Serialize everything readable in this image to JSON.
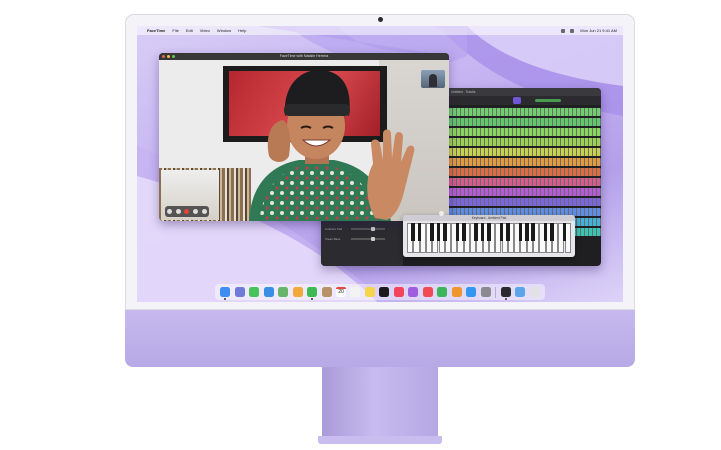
{
  "menubar": {
    "apple": "",
    "app": "FaceTime",
    "items": [
      "File",
      "Edit",
      "Video",
      "Window",
      "Help"
    ],
    "clock": "Mon Jun 21 9:41 AM"
  },
  "facetime": {
    "title": "FaceTime with Natalie Herrera"
  },
  "logic": {
    "title": "Untitled - Tracks",
    "mixer_rows": [
      "Input Chorus",
      "Ambient Pad",
      "Clean Bass"
    ],
    "track_colors": [
      "#6fd16c",
      "#5fca6a",
      "#86d85a",
      "#9ad34f",
      "#c8d24b",
      "#e59a3c",
      "#e06b3f",
      "#d85a8d",
      "#b75ad8",
      "#7c65e2",
      "#5d8de6",
      "#3fb3d9",
      "#35c7b4"
    ]
  },
  "keyboard": {
    "title": "Keyboard - Ambient Pad"
  },
  "dock": {
    "calendar_day": "20",
    "icons": [
      {
        "name": "finder-icon",
        "color": "#3d8ef0"
      },
      {
        "name": "launchpad-icon",
        "color": "#6e7bd8"
      },
      {
        "name": "messages-icon",
        "color": "#46c35a"
      },
      {
        "name": "mail-icon",
        "color": "#3a8ee6"
      },
      {
        "name": "maps-icon",
        "color": "#67b56a"
      },
      {
        "name": "photos-icon",
        "color": "#f1a93c"
      },
      {
        "name": "facetime-icon",
        "color": "#3dbb52"
      },
      {
        "name": "contacts-icon",
        "color": "#b9926a"
      },
      {
        "name": "calendar-icon",
        "color": "#ffffff"
      },
      {
        "name": "reminders-icon",
        "color": "#f3f3f3"
      },
      {
        "name": "notes-icon",
        "color": "#f6d44c"
      },
      {
        "name": "tv-icon",
        "color": "#1b1b1d"
      },
      {
        "name": "music-icon",
        "color": "#f3445e"
      },
      {
        "name": "podcasts-icon",
        "color": "#a05de0"
      },
      {
        "name": "news-icon",
        "color": "#f04b55"
      },
      {
        "name": "numbers-icon",
        "color": "#3ab55a"
      },
      {
        "name": "pages-icon",
        "color": "#f0962e"
      },
      {
        "name": "app-store-icon",
        "color": "#3596f0"
      },
      {
        "name": "system-preferences-icon",
        "color": "#8a8a90"
      },
      {
        "name": "logic-pro-icon",
        "color": "#2a2a2e"
      },
      {
        "name": "downloads-folder-icon",
        "color": "#5aa6e8"
      },
      {
        "name": "trash-icon",
        "color": "#e2e2e6"
      }
    ]
  }
}
